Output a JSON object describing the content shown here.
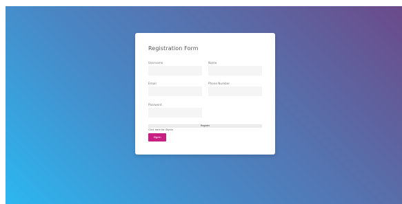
{
  "form": {
    "title": "Registration Form",
    "fields": {
      "username": {
        "label": "Username",
        "value": ""
      },
      "name": {
        "label": "Name",
        "value": ""
      },
      "email": {
        "label": "Email",
        "value": ""
      },
      "phone": {
        "label": "Phone Number",
        "value": ""
      },
      "password": {
        "label": "Password",
        "value": ""
      }
    },
    "register_label": "Register",
    "signin_hint": "Click here for Signin",
    "signin_label": "Signin"
  },
  "colors": {
    "accent": "#c71f82",
    "gradient_top_right": "#6b4a8a",
    "gradient_bottom_left": "#2cb7f0"
  }
}
